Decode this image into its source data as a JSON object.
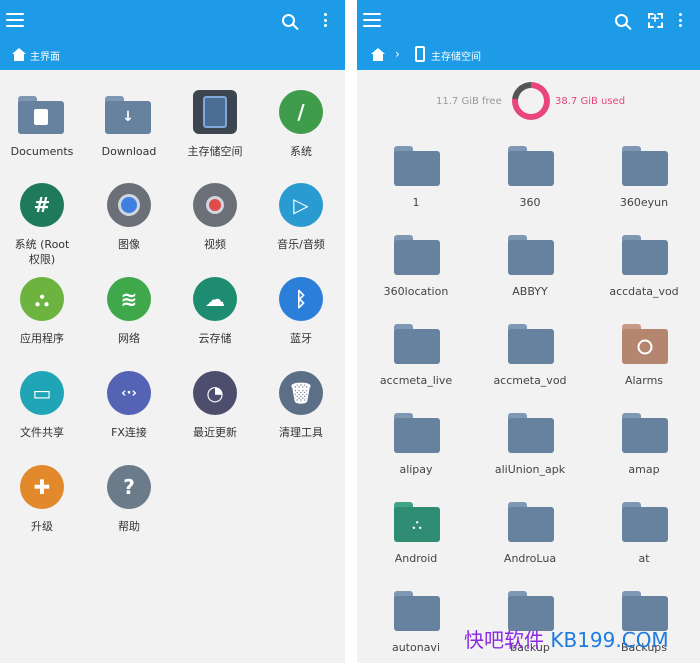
{
  "colors": {
    "toolbar": "#1e9be6",
    "background": "#f2f2f2",
    "folder": "#66829f",
    "folder_tab": "#7e98b4",
    "android_folder": "#2f8d74",
    "alarms_folder": "#b48670",
    "used": "#e8467c",
    "watermark": "#8a2be2"
  },
  "left": {
    "breadcrumb": "主界面",
    "items": [
      {
        "label": "Documents",
        "icon": "documents-folder-icon",
        "color": "#66829f"
      },
      {
        "label": "Download",
        "icon": "download-folder-icon",
        "color": "#66829f"
      },
      {
        "label": "主存储空间",
        "icon": "phone-storage-icon",
        "color": "#4b6e95"
      },
      {
        "label": "系统",
        "icon": "system-slash-icon",
        "color": "#3e9c4a"
      },
      {
        "label": "系统 (Root\n权限)",
        "icon": "root-hash-icon",
        "color": "#1f7a5c"
      },
      {
        "label": "图像",
        "icon": "image-icon",
        "color": "#6a6f78"
      },
      {
        "label": "视频",
        "icon": "video-icon",
        "color": "#6a6f78"
      },
      {
        "label": "音乐/音频",
        "icon": "play-icon",
        "color": "#2a9bd1"
      },
      {
        "label": "应用程序",
        "icon": "android-icon",
        "color": "#6cb33f"
      },
      {
        "label": "网络",
        "icon": "wifi-icon",
        "color": "#3ea84a"
      },
      {
        "label": "云存储",
        "icon": "cloud-icon",
        "color": "#1e8c70"
      },
      {
        "label": "蓝牙",
        "icon": "bluetooth-icon",
        "color": "#2b7fd9"
      },
      {
        "label": "文件共享",
        "icon": "file-share-icon",
        "color": "#1fa5b5"
      },
      {
        "label": "FX连接",
        "icon": "fx-connect-icon",
        "color": "#5463b3"
      },
      {
        "label": "最近更新",
        "icon": "clock-icon",
        "color": "#4d4d6e"
      },
      {
        "label": "清理工具",
        "icon": "trash-icon",
        "color": "#5b6f86"
      },
      {
        "label": "升级",
        "icon": "puzzle-icon",
        "color": "#e28a2b"
      },
      {
        "label": "帮助",
        "icon": "help-icon",
        "color": "#6b7b8a"
      }
    ]
  },
  "right": {
    "breadcrumb": "主存储空间",
    "storage": {
      "free": "11.7 GiB free",
      "used": "38.7 GiB used",
      "used_fraction": 0.77
    },
    "folders": [
      {
        "label": "1",
        "kind": "plain"
      },
      {
        "label": "360",
        "kind": "plain"
      },
      {
        "label": "360eyun",
        "kind": "plain"
      },
      {
        "label": "360location",
        "kind": "plain"
      },
      {
        "label": "ABBYY",
        "kind": "plain"
      },
      {
        "label": "accdata_vod",
        "kind": "plain"
      },
      {
        "label": "accmeta_live",
        "kind": "plain"
      },
      {
        "label": "accmeta_vod",
        "kind": "plain"
      },
      {
        "label": "Alarms",
        "kind": "alarms"
      },
      {
        "label": "alipay",
        "kind": "plain"
      },
      {
        "label": "aliUnion_apk",
        "kind": "plain"
      },
      {
        "label": "amap",
        "kind": "plain"
      },
      {
        "label": "Android",
        "kind": "android"
      },
      {
        "label": "AndroLua",
        "kind": "plain"
      },
      {
        "label": "at",
        "kind": "plain"
      },
      {
        "label": "autonavi",
        "kind": "plain"
      },
      {
        "label": "backup",
        "kind": "plain"
      },
      {
        "label": "Backups",
        "kind": "plain"
      }
    ]
  },
  "watermark": {
    "part1": "快吧软件",
    "part2": " KB199.COM"
  }
}
